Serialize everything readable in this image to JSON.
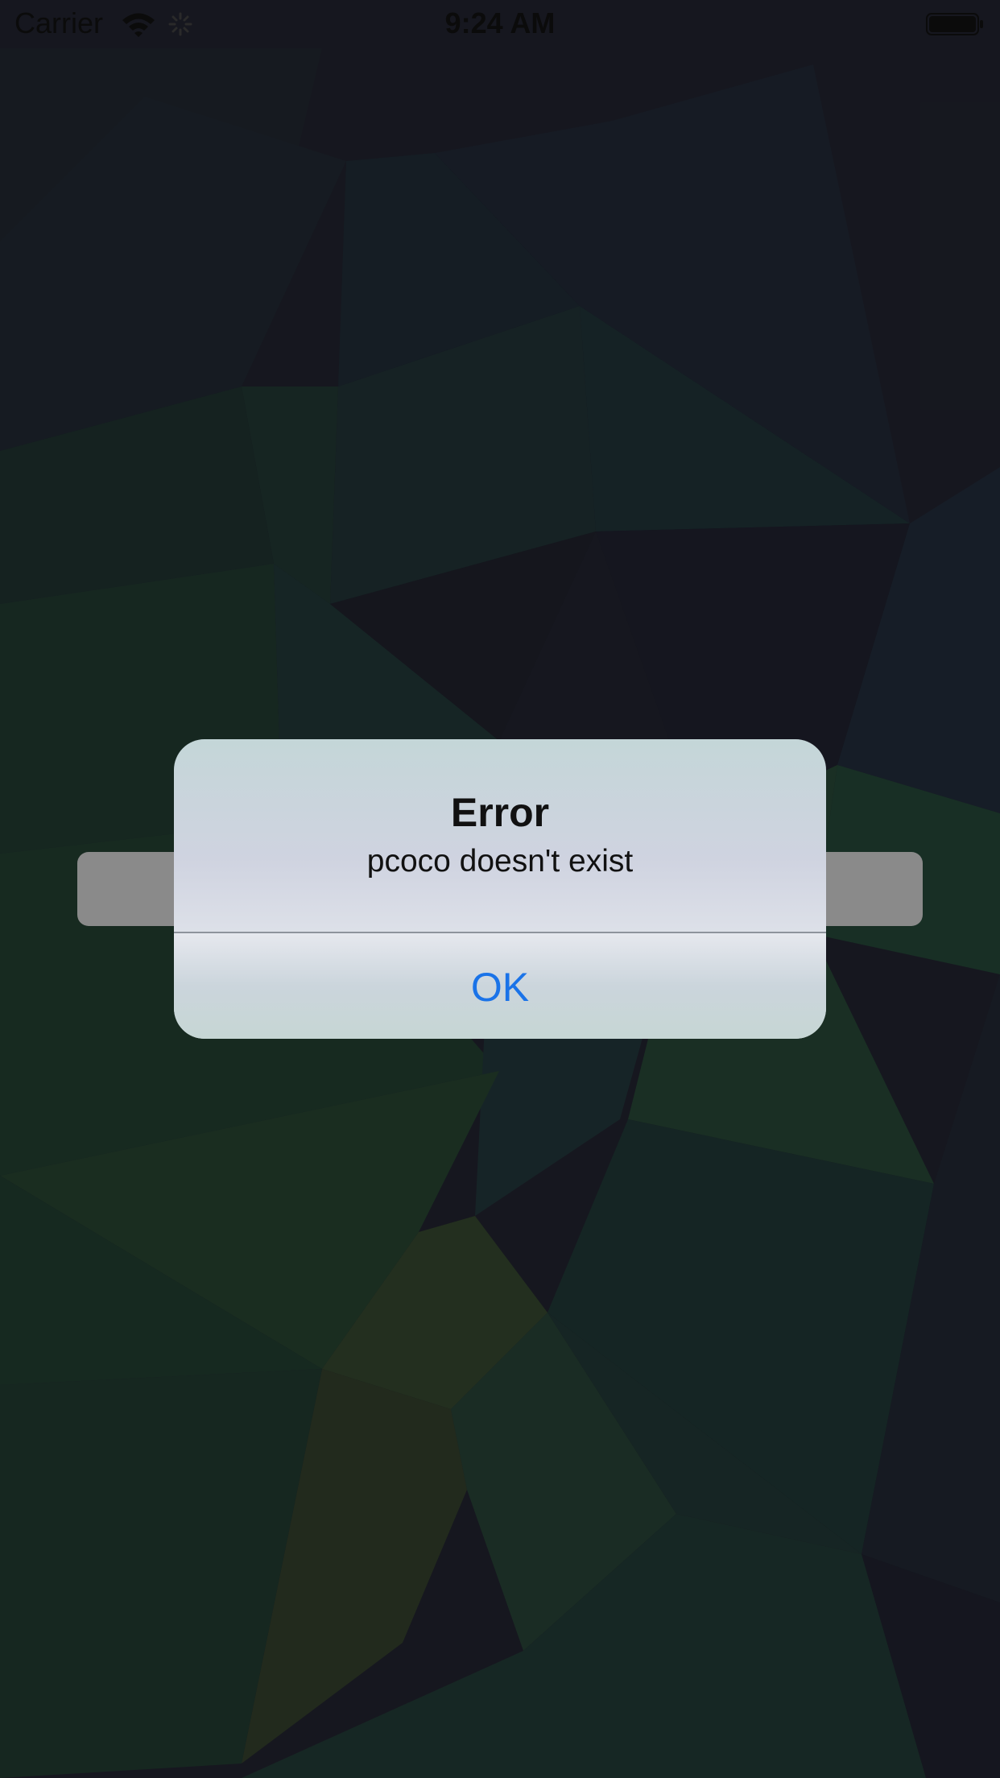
{
  "status_bar": {
    "carrier": "Carrier",
    "time": "9:24 AM",
    "wifi_icon": "wifi-icon",
    "activity_icon": "activity-spinner-icon",
    "battery_icon": "battery-icon"
  },
  "alert": {
    "title": "Error",
    "message": "pcoco doesn't exist",
    "ok_label": "OK",
    "ok_color": "#1a73e8"
  }
}
